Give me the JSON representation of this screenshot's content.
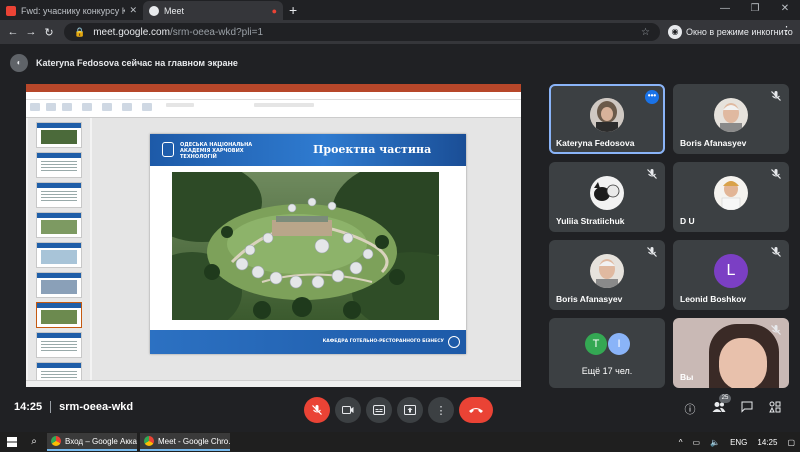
{
  "browser": {
    "tabs": [
      {
        "title": "Fwd: учаснику конкурсу КРАЩ...",
        "favicon": "gmail-icon"
      },
      {
        "title": "Meet",
        "favicon": "meet-icon"
      }
    ],
    "new_tab": "+",
    "url_host": "meet.google.com",
    "url_path": "/srm-oeea-wkd?pli=1",
    "incognito_label": "Окно в режиме инкогнито"
  },
  "meet": {
    "presenting_banner": "Kateryna Fedosova сейчас на главном экране",
    "time": "14:25",
    "meeting_code": "srm-oeea-wkd",
    "participant_count": "25",
    "accent_color": "#8ab4f8",
    "end_call_color": "#ea4335"
  },
  "slide": {
    "academy": "ОДЕСЬКА НАЦІОНАЛЬНА АКАДЕМІЯ ХАРЧОВИХ ТЕХНОЛОГІЙ",
    "title": "Проектна частина",
    "footer": "КАФЕДРА ГОТЕЛЬНО-РЕСТОРАННОГО БІЗНЕСУ"
  },
  "participants": [
    {
      "name": "Kateryna Fedosova",
      "avatar": "photo",
      "state": "more-options"
    },
    {
      "name": "Boris Afanasyev",
      "avatar": "photo",
      "state": "muted"
    },
    {
      "name": "Yuliia Stratiichuk",
      "avatar": "photo",
      "state": "muted"
    },
    {
      "name": "D U",
      "avatar": "photo",
      "state": "muted"
    },
    {
      "name": "Boris Afanasyev",
      "avatar": "photo",
      "state": "muted"
    },
    {
      "name": "Leonid Boshkov",
      "avatar": "L",
      "state": "muted"
    },
    {
      "name": "Ещё 17 чел.",
      "avatars": [
        "T",
        "I"
      ]
    },
    {
      "name": "Вы",
      "avatar": "camera",
      "state": "muted"
    }
  ],
  "taskbar": {
    "tasks": [
      "Вход – Google Аккау...",
      "Meet - Google Chro..."
    ],
    "lang": "ENG",
    "clock": "14:25"
  }
}
